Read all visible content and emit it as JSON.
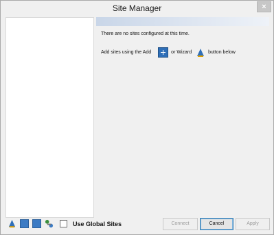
{
  "window": {
    "title": "Site Manager",
    "close_symbol": "×"
  },
  "messages": {
    "no_sites": "There are no sites configured at this time.",
    "add_prefix": "Add sites using the Add",
    "add_mid": "or Wizard",
    "add_suffix": "button below"
  },
  "footer": {
    "use_global_sites_label": "Use Global Sites",
    "use_global_sites_checked": false,
    "icons": [
      "wizard-icon",
      "site-list-icon",
      "back-icon",
      "network-icon"
    ]
  },
  "buttons": {
    "connect": "Connect",
    "cancel": "Cancel",
    "apply": "Apply"
  }
}
